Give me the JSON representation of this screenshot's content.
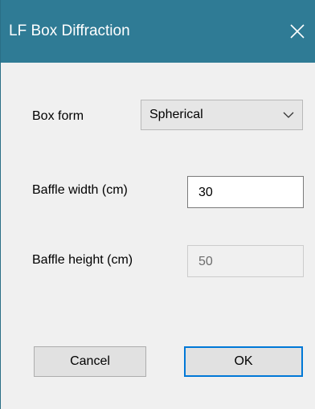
{
  "window": {
    "title": "LF Box Diffraction",
    "close_icon": "close-icon"
  },
  "form": {
    "box_form": {
      "label": "Box form",
      "selected": "Spherical"
    },
    "baffle_width": {
      "label": "Baffle width (cm)",
      "value": "30",
      "enabled": true
    },
    "baffle_height": {
      "label": "Baffle height (cm)",
      "value": "50",
      "enabled": false
    }
  },
  "buttons": {
    "cancel": "Cancel",
    "ok": "OK"
  },
  "colors": {
    "titlebar": "#2f7b95",
    "accent": "#0078d7"
  }
}
